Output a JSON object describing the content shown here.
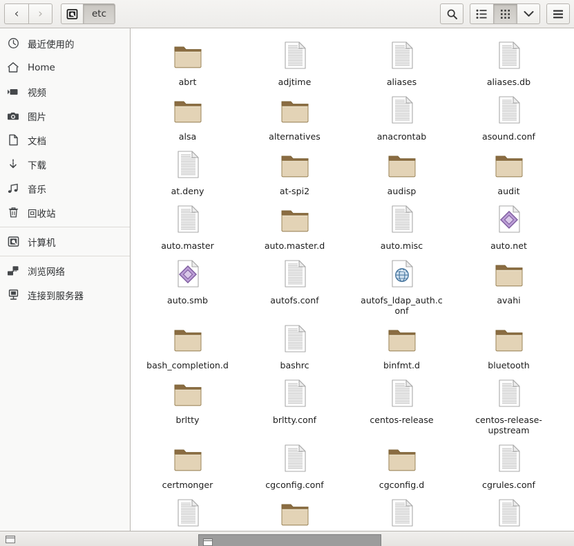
{
  "window": {
    "title": "etc",
    "app": "files-manager"
  },
  "toolbar": {
    "back_label": "‹",
    "forward_label": "›",
    "breadcrumb": [
      {
        "name": "computer-crumb",
        "icon": "computer-icon",
        "label": ""
      },
      {
        "name": "etc-crumb",
        "icon": "",
        "label": "etc"
      }
    ],
    "search_label": "search-icon",
    "list_view_label": "list-view-icon",
    "grid_view_label": "grid-view-icon",
    "options_label": "chevron-down-icon",
    "menu_label": "hamburger-menu-icon"
  },
  "sidebar": {
    "items": [
      {
        "label": "最近使用的",
        "icon": "clock-icon",
        "name": "sidebar-item-recent"
      },
      {
        "label": "Home",
        "icon": "home-icon",
        "name": "sidebar-item-home"
      },
      {
        "label": "视频",
        "icon": "video-icon",
        "name": "sidebar-item-videos"
      },
      {
        "label": "图片",
        "icon": "camera-icon",
        "name": "sidebar-item-pictures"
      },
      {
        "label": "文档",
        "icon": "document-icon",
        "name": "sidebar-item-documents"
      },
      {
        "label": "下载",
        "icon": "download-icon",
        "name": "sidebar-item-downloads"
      },
      {
        "label": "音乐",
        "icon": "music-icon",
        "name": "sidebar-item-music"
      },
      {
        "label": "回收站",
        "icon": "trash-icon",
        "name": "sidebar-item-trash"
      },
      {
        "label": "计算机",
        "icon": "computer-icon",
        "name": "sidebar-item-computer"
      },
      {
        "label": "浏览网络",
        "icon": "network-icon",
        "name": "sidebar-item-browse-network"
      },
      {
        "label": "连接到服务器",
        "icon": "server-icon",
        "name": "sidebar-item-connect-server"
      }
    ],
    "separator_after": [
      7,
      8
    ]
  },
  "files": [
    {
      "name": "abrt",
      "type": "folder"
    },
    {
      "name": "adjtime",
      "type": "text"
    },
    {
      "name": "aliases",
      "type": "text"
    },
    {
      "name": "aliases.db",
      "type": "text"
    },
    {
      "name": "alsa",
      "type": "folder"
    },
    {
      "name": "alternatives",
      "type": "folder"
    },
    {
      "name": "anacrontab",
      "type": "text"
    },
    {
      "name": "asound.conf",
      "type": "text"
    },
    {
      "name": "at.deny",
      "type": "text"
    },
    {
      "name": "at-spi2",
      "type": "folder"
    },
    {
      "name": "audisp",
      "type": "folder"
    },
    {
      "name": "audit",
      "type": "folder"
    },
    {
      "name": "auto.master",
      "type": "text"
    },
    {
      "name": "auto.master.d",
      "type": "folder"
    },
    {
      "name": "auto.misc",
      "type": "text"
    },
    {
      "name": "auto.net",
      "type": "script"
    },
    {
      "name": "auto.smb",
      "type": "script"
    },
    {
      "name": "autofs.conf",
      "type": "text"
    },
    {
      "name": "autofs_ldap_auth.conf",
      "type": "web"
    },
    {
      "name": "avahi",
      "type": "folder"
    },
    {
      "name": "bash_completion.d",
      "type": "folder"
    },
    {
      "name": "bashrc",
      "type": "text"
    },
    {
      "name": "binfmt.d",
      "type": "folder"
    },
    {
      "name": "bluetooth",
      "type": "folder"
    },
    {
      "name": "brltty",
      "type": "folder"
    },
    {
      "name": "brltty.conf",
      "type": "text"
    },
    {
      "name": "centos-release",
      "type": "text"
    },
    {
      "name": "centos-release-upstream",
      "type": "text"
    },
    {
      "name": "certmonger",
      "type": "folder"
    },
    {
      "name": "cgconfig.conf",
      "type": "text"
    },
    {
      "name": "cgconfig.d",
      "type": "folder"
    },
    {
      "name": "cgrules.conf",
      "type": "text"
    },
    {
      "name": "",
      "type": "text"
    },
    {
      "name": "",
      "type": "folder"
    },
    {
      "name": "",
      "type": "text"
    },
    {
      "name": "",
      "type": "text"
    }
  ],
  "colors": {
    "folder_face": "#e3d3b6",
    "folder_tab": "#8a6c42",
    "folder_border": "#9b8458",
    "doc_face": "#ffffff",
    "doc_line": "#b9b9b9",
    "script_accent": "#9f7fbf",
    "web_accent": "#4e7fae",
    "toolbar_bg": "#eeedea",
    "sidebar_bg": "#f9f9f8",
    "panel_bg": "#e9e7e4"
  }
}
